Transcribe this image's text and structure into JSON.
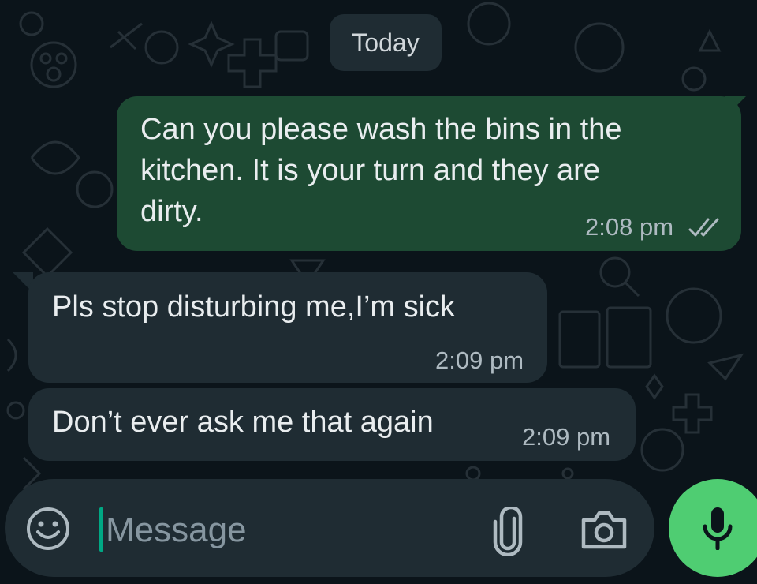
{
  "date_chip": "Today",
  "messages": [
    {
      "direction": "outgoing",
      "text": "Can you please wash the bins in the\nkitchen. It is your turn and they are\ndirty.",
      "time": "2:08 pm",
      "status": "read"
    },
    {
      "direction": "incoming",
      "text": "Pls stop disturbing me,I’m sick",
      "time": "2:09 pm"
    },
    {
      "direction": "incoming",
      "text": "Don’t ever ask me that again",
      "time": "2:09 pm"
    }
  ],
  "composer": {
    "placeholder": "Message",
    "icons": [
      "emoji-icon",
      "attach-icon",
      "camera-icon",
      "microphone-icon"
    ]
  },
  "colors": {
    "background": "#0b141a",
    "outgoing_bubble": "#1d4a33",
    "incoming_bubble": "#1f2c33",
    "accent": "#4fcd72"
  }
}
